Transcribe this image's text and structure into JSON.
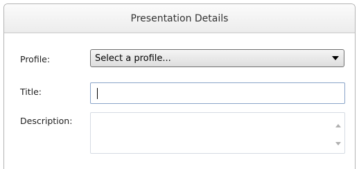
{
  "header": {
    "title": "Presentation Details"
  },
  "form": {
    "profile": {
      "label": "Profile:",
      "selected": "Select a profile..."
    },
    "title": {
      "label": "Title:",
      "value": ""
    },
    "description": {
      "label": "Description:",
      "value": ""
    }
  },
  "icons": {
    "dropdown": "chevron-down-icon",
    "scroll_up": "scroll-up-icon",
    "scroll_down": "scroll-down-icon"
  }
}
